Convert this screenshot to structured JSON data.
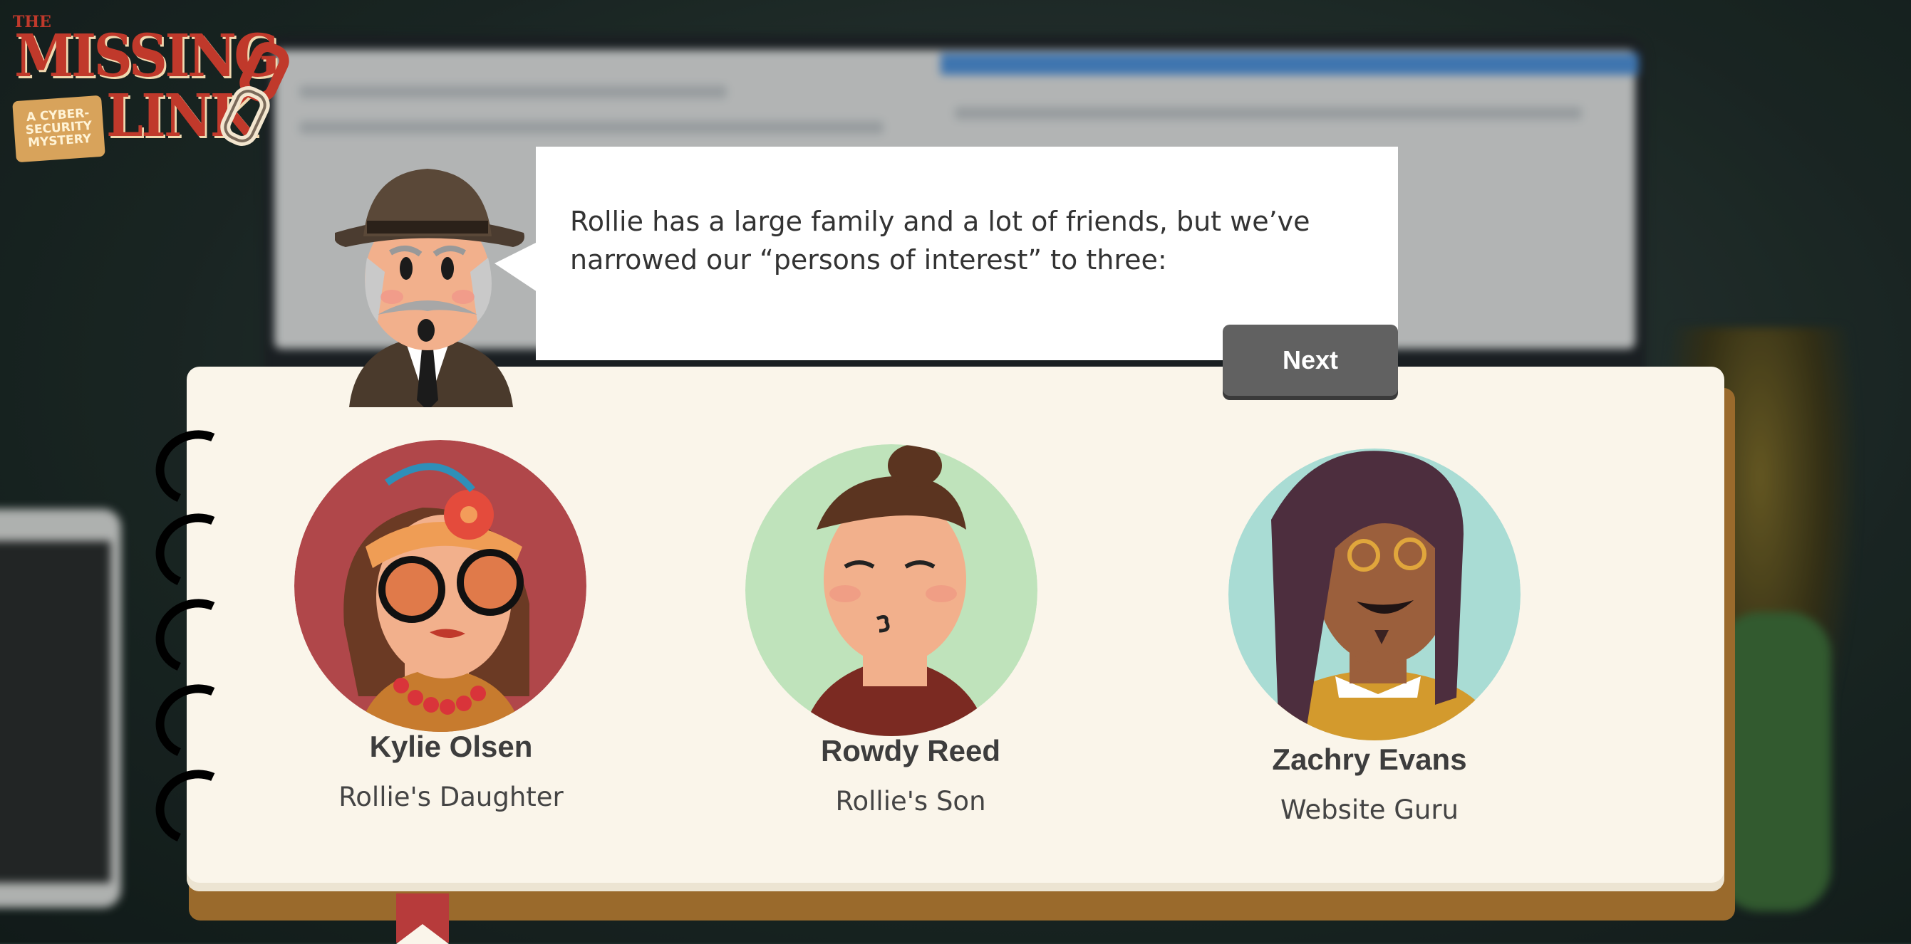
{
  "game": {
    "logo": {
      "the": "THE",
      "title_line1": "MISSING",
      "title_line2": "LINK",
      "badge": "A CYBER-SECURITY MYSTERY"
    }
  },
  "dialog": {
    "text": "Rollie has a large family and a lot of friends, but we’ve narrowed our “persons of interest” to three:",
    "next_label": "Next"
  },
  "persons": [
    {
      "name": "Kylie Olsen",
      "role": "Rollie's Daughter",
      "bg_color": "#b0474a"
    },
    {
      "name": "Rowdy Reed",
      "role": "Rollie's Son",
      "bg_color": "#bfe3bb"
    },
    {
      "name": "Zachry Evans",
      "role": "Website Guru",
      "bg_color": "#a9dcd4"
    }
  ],
  "colors": {
    "accent_red": "#c0392b",
    "button": "#616161",
    "notebook_page": "#faf5ea",
    "notebook_cover": "#9a6a2c"
  }
}
